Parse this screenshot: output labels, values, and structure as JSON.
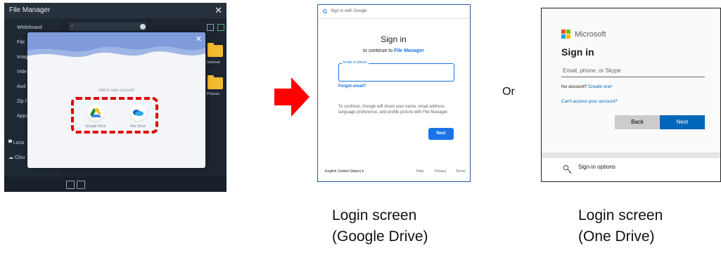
{
  "file_manager": {
    "title": "File Manager",
    "close_icon": "close-icon",
    "sidebar": [
      "Whiteboard",
      "File",
      "Imag",
      "Vide",
      "Aud",
      "Zip f",
      "Apps"
    ],
    "locations": [
      "Loca",
      "Clou"
    ],
    "folder_labels": [
      "ownload",
      "Pictures"
    ],
    "dialog": {
      "add_label": "Add a new account",
      "accounts": [
        {
          "name": "Google Drive",
          "icon": "google-drive-icon"
        },
        {
          "name": "One Drive",
          "icon": "onedrive-icon"
        }
      ],
      "highlight_color": "#e00000"
    }
  },
  "google": {
    "header": "Sign in with Google",
    "title": "Sign in",
    "continue_prefix": "to continue to ",
    "app_name": "File Manager",
    "field_label": "Email or phone",
    "forgot": "Forgot email?",
    "info": "To continue, Google will share your name, email address, language preference, and profile picture with File Manager.",
    "next": "Next",
    "language": "English (United States)",
    "links": [
      "Help",
      "Privacy",
      "Terms"
    ],
    "accent": "#1a73e8"
  },
  "or_label": "Or",
  "microsoft": {
    "brand": "Microsoft",
    "title": "Sign in",
    "placeholder": "Email, phone, or Skype",
    "no_account": "No account?",
    "create": "Create one!",
    "cant_access": "Can't access your account?",
    "back": "Back",
    "next": "Next",
    "signin_options": "Sign-in options",
    "accent": "#0067b8"
  },
  "captions": {
    "google_line1": "Login screen",
    "google_line2": "(Google Drive)",
    "ms_line1": "Login screen",
    "ms_line2": "(One Drive)"
  }
}
